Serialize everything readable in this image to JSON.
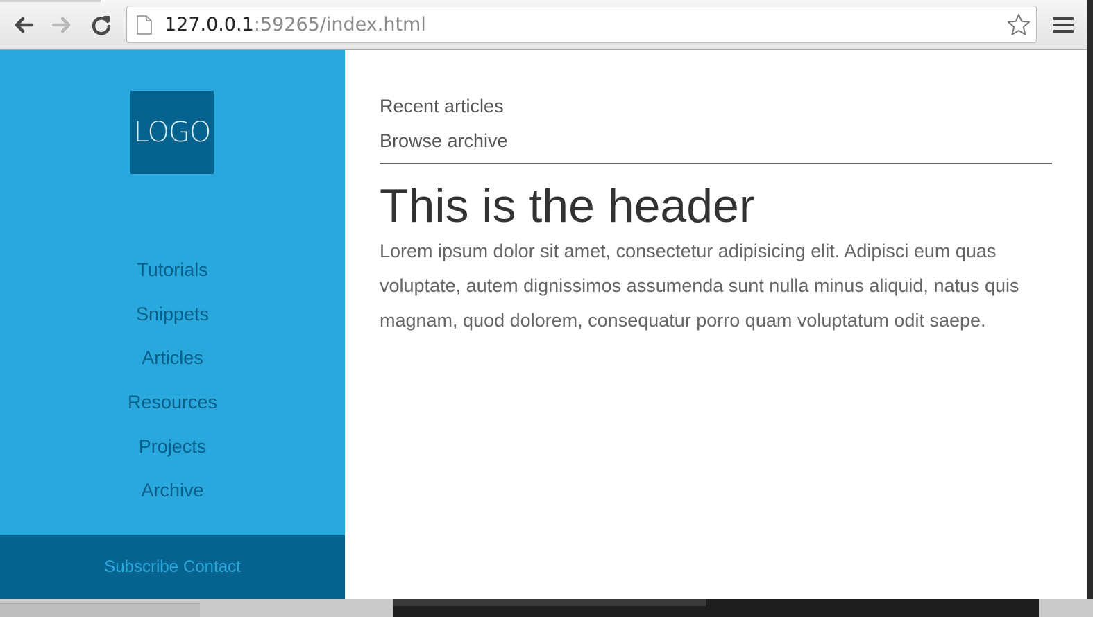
{
  "browser": {
    "url_host": "127.0.0.1",
    "url_rest": ":59265/index.html"
  },
  "sidebar": {
    "logo_text": "LOGO",
    "nav": [
      {
        "label": "Tutorials"
      },
      {
        "label": "Snippets"
      },
      {
        "label": "Articles"
      },
      {
        "label": "Resources"
      },
      {
        "label": "Projects"
      },
      {
        "label": "Archive"
      }
    ],
    "footer": {
      "subscribe": "Subscribe",
      "contact": "Contact"
    }
  },
  "main": {
    "links": {
      "recent": "Recent articles",
      "archive": "Browse archive"
    },
    "header": "This is the header",
    "body": "Lorem ipsum dolor sit amet, consectetur adipisicing elit. Adipisci eum quas voluptate, autem dignissimos assumenda sunt nulla minus aliquid, natus quis magnam, quod dolorem, consequatur porro quam voluptatum odit saepe."
  },
  "colors": {
    "sidebar": "#28a8dc",
    "sidebar_dark": "#06638f",
    "nav_link": "#0a5f8a"
  }
}
